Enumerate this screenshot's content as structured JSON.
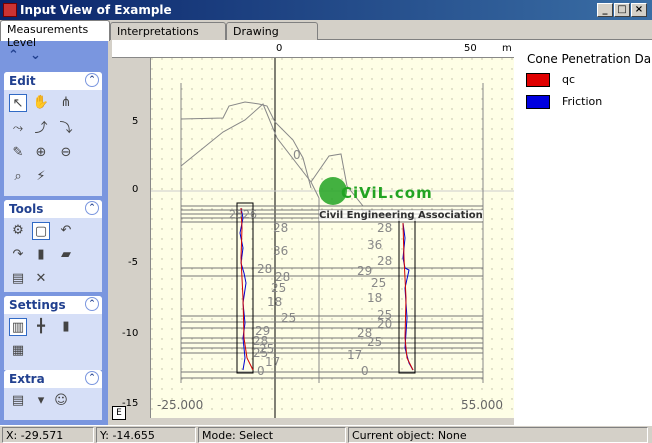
{
  "window": {
    "title": "Input View of Example",
    "minimize": "_",
    "restore": "□",
    "close": "×"
  },
  "tabs": [
    {
      "label": "Measurements Level"
    },
    {
      "label": "Interpretations Level"
    },
    {
      "label": "Drawing Level"
    }
  ],
  "sidebar": {
    "panels": {
      "edit": "Edit",
      "tools": "Tools",
      "settings": "Settings",
      "extra": "Extra"
    }
  },
  "ruler": {
    "top_ticks": [
      "0",
      "50",
      "m"
    ],
    "left_ticks": [
      "5",
      "0",
      "-5",
      "-10",
      "-15"
    ]
  },
  "plot": {
    "x_left_label": "-25.000",
    "x_right_label": "55.000",
    "watermark_top": "CiViL.com",
    "watermark_sub": "Civil Engineering Association",
    "profile_label": "0",
    "numbers_left": [
      "25",
      "26",
      "28",
      "36",
      "28",
      "28",
      "25",
      "18",
      "25",
      "29",
      "28",
      "25",
      "25",
      "17",
      "0"
    ],
    "numbers_right": [
      "25",
      "28",
      "36",
      "28",
      "29",
      "25",
      "18",
      "25",
      "20",
      "28",
      "25",
      "17",
      "0"
    ]
  },
  "legend": {
    "title": "Cone Penetration Da",
    "items": [
      {
        "label": "qc",
        "color": "#e00000"
      },
      {
        "label": "Friction",
        "color": "#0000e0"
      }
    ]
  },
  "status": {
    "x": "X: -29.571",
    "y": "Y: -14.655",
    "mode": "Mode: Select",
    "object": "Current object: None"
  },
  "e_button": "E"
}
